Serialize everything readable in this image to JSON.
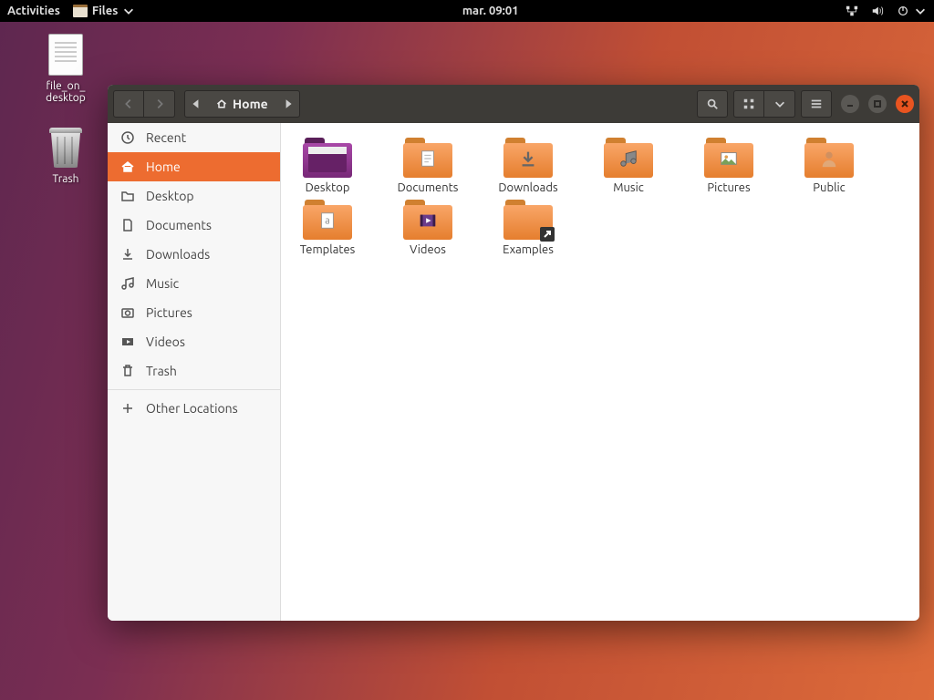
{
  "panel": {
    "activities": "Activities",
    "files_label": "Files",
    "clock": "mar. 09:01"
  },
  "desktop_icons": {
    "file": "file_on_\ndesktop",
    "trash": "Trash"
  },
  "window": {
    "path_label": "Home"
  },
  "sidebar": {
    "items": [
      {
        "label": "Recent"
      },
      {
        "label": "Home"
      },
      {
        "label": "Desktop"
      },
      {
        "label": "Documents"
      },
      {
        "label": "Downloads"
      },
      {
        "label": "Music"
      },
      {
        "label": "Pictures"
      },
      {
        "label": "Videos"
      },
      {
        "label": "Trash"
      }
    ],
    "other": "Other Locations"
  },
  "folders": [
    {
      "label": "Desktop",
      "kind": "desktop"
    },
    {
      "label": "Documents",
      "kind": "documents"
    },
    {
      "label": "Downloads",
      "kind": "downloads"
    },
    {
      "label": "Music",
      "kind": "music"
    },
    {
      "label": "Pictures",
      "kind": "pictures"
    },
    {
      "label": "Public",
      "kind": "public"
    },
    {
      "label": "Templates",
      "kind": "templates"
    },
    {
      "label": "Videos",
      "kind": "videos"
    },
    {
      "label": "Examples",
      "kind": "examples"
    }
  ]
}
